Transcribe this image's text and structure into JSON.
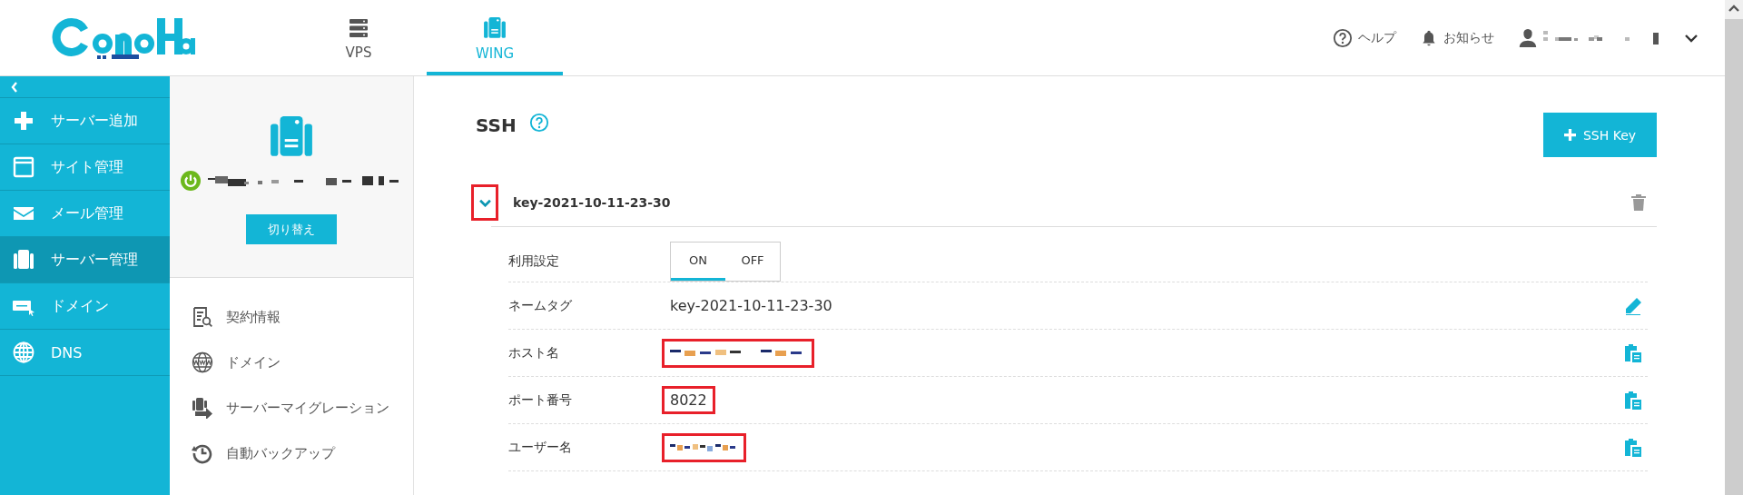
{
  "header": {
    "tabs": [
      {
        "label": "VPS",
        "selected": false
      },
      {
        "label": "WING",
        "selected": true
      }
    ],
    "links": [
      {
        "label": "ヘルプ"
      },
      {
        "label": "お知らせ"
      }
    ]
  },
  "sidebar": {
    "items": [
      {
        "label": "サーバー追加",
        "selected": false
      },
      {
        "label": "サイト管理",
        "selected": false
      },
      {
        "label": "メール管理",
        "selected": false
      },
      {
        "label": "サーバー管理",
        "selected": true
      },
      {
        "label": "ドメイン",
        "selected": false
      },
      {
        "label": "DNS",
        "selected": false
      }
    ]
  },
  "server_panel": {
    "switch_button": "切り替え",
    "menu": [
      {
        "label": "契約情報"
      },
      {
        "label": "ドメイン"
      },
      {
        "label": "サーバーマイグレーション"
      },
      {
        "label": "自動バックアップ"
      }
    ]
  },
  "content": {
    "title": "SSH",
    "add_button": "SSH Key",
    "key": {
      "name": "key-2021-10-11-23-30",
      "expanded": true,
      "highlighted": true,
      "rows": [
        {
          "kind": "toggle",
          "label": "利用設定",
          "options": [
            {
              "label": "ON",
              "selected": true
            },
            {
              "label": "OFF",
              "selected": false
            }
          ]
        },
        {
          "kind": "text",
          "label": "ネームタグ",
          "value": "key-2021-10-11-23-30",
          "highlighted": false
        },
        {
          "kind": "redacted",
          "label": "ホスト名",
          "highlighted": true
        },
        {
          "kind": "text",
          "label": "ポート番号",
          "value": "8022",
          "highlighted": true
        },
        {
          "kind": "redacted",
          "label": "ユーザー名",
          "highlighted": true
        }
      ]
    }
  }
}
